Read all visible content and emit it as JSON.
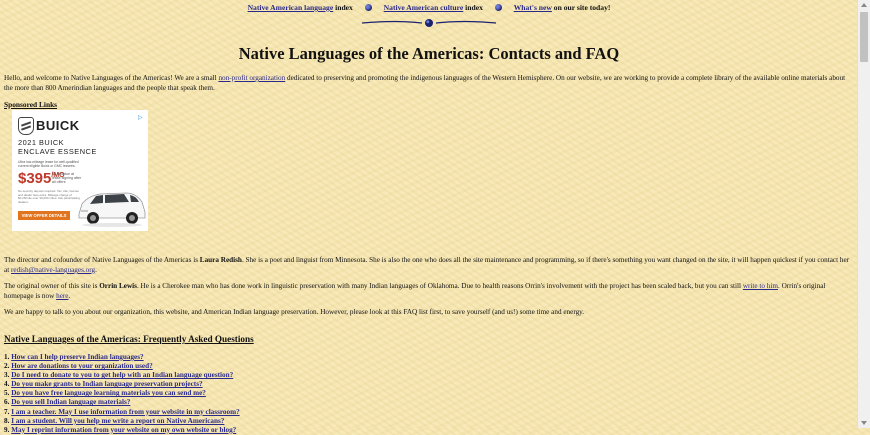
{
  "nav": {
    "items": [
      {
        "link": "Native American language",
        "suffix": "index"
      },
      {
        "link": "Native American culture",
        "suffix": "index"
      },
      {
        "link": "What's new",
        "suffix": "on our site today!"
      }
    ]
  },
  "page_title": "Native Languages of the Americas: Contacts and FAQ",
  "intro": {
    "before": "Hello, and welcome to Native Languages of the Americas! We are a small ",
    "link": "non-profit organization",
    "after": " dedicated to preserving and promoting the indigenous languages of the Western Hemisphere. On our website, we are working to provide a complete library of the available online materials about the more than 800 Amerindian languages and the people that speak them."
  },
  "sponsored_label": "Sponsored Links",
  "ad": {
    "brand": "BUICK",
    "model_year": "2021 BUICK",
    "model_name": "ENCLAVE ESSENCE",
    "fine_print": "Ultra low-mileage lease for well-qualified current eligible Buick or GMC lessees.",
    "price": "$395",
    "price_sup": "/MO",
    "price_note": "$3,895 due at lease signing after all offers",
    "fine_print_2": "No security deposit required. Tax, title, license and dealer fees extra. Mileage charge of $0.25/mile over 30,000 miles. Ask participating dealers.",
    "cta": "VIEW OFFER DETAILS",
    "adchoices_icon": "adchoices-icon"
  },
  "director": {
    "before": "The director and cofounder of Native Languages of the Americas is ",
    "name": "Laura Redish",
    "after": ". She is a poet and linguist from Minnesota. She is also the one who does all the site maintenance and programming, so if there's something you want changed on the site, it will happen quickest if you contact her at ",
    "email": "redish@native-languages.org",
    "end": "."
  },
  "owner": {
    "before": "The original owner of this site is ",
    "name": "Orrin Lewis",
    "middle": ". He is a Cherokee man who has done work in linguistic preservation with many Indian languages of Oklahoma. Due to health reasons Orrin's involvement with the project has been scaled back, but you can still ",
    "write_link": "write to him",
    "after": ". Orrin's original homepage is now ",
    "here_link": "here",
    "end": "."
  },
  "happy_text": "We are happy to talk to you about our organization, this website, and American Indian language preservation. However, please look at this FAQ list first, to save yourself (and us!) some time and energy.",
  "faq_heading": "Native Languages of the Americas: Frequently Asked Questions",
  "faq": [
    {
      "num": "1.",
      "q": "How can I help preserve Indian languages?"
    },
    {
      "num": "2.",
      "q": "How are donations to your organization used?"
    },
    {
      "num": "3.",
      "q": "Do I need to donate to you to get help with an Indian language question?"
    },
    {
      "num": "4.",
      "q": "Do you make grants to Indian language preservation projects?"
    },
    {
      "num": "5.",
      "q": "Do you have free language learning materials you can send me?"
    },
    {
      "num": "6.",
      "q": "Do you sell Indian language materials?"
    },
    {
      "num": "7.",
      "q": "I am a teacher. May I use information from your website in my classroom?"
    },
    {
      "num": "8.",
      "q": "I am a student. Will you help me write a report on Native Americans?"
    },
    {
      "num": "9.",
      "q": "May I reprint information from your website on my own website or blog?"
    }
  ],
  "colors": {
    "background": "#f6e7b3",
    "link": "#2a2a8a",
    "globe": "#1b2370",
    "price": "#c0392b",
    "cta": "#e0741f"
  }
}
